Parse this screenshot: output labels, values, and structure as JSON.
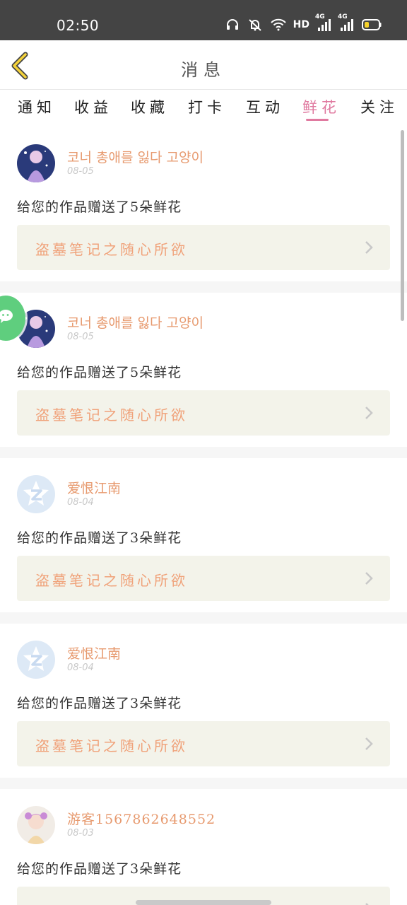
{
  "status_bar": {
    "time": "02:50",
    "network_label": "HD",
    "signal1_label": "4G",
    "signal2_label": "4G",
    "icons": [
      "headset-icon",
      "bell-muted-icon",
      "wifi-icon",
      "signal-icon",
      "signal-icon",
      "battery-icon"
    ],
    "battery_level": 0.25
  },
  "header": {
    "title": "消息",
    "back_icon": "chevron-left-icon"
  },
  "tabs": [
    {
      "label": "通知",
      "active": false
    },
    {
      "label": "收益",
      "active": false
    },
    {
      "label": "收藏",
      "active": false
    },
    {
      "label": "打卡",
      "active": false
    },
    {
      "label": "互动",
      "active": false
    },
    {
      "label": "鲜花",
      "active": true
    },
    {
      "label": "关注",
      "active": false
    }
  ],
  "messages": [
    {
      "sender": "코너 총애를 잃다 고양이",
      "date": "08-05",
      "text": "给您的作品赠送了5朵鲜花",
      "work_title": "盗墓笔记之随心所欲",
      "avatar": "anime-girl-avatar"
    },
    {
      "sender": "코너 총애를 잃다 고양이",
      "date": "08-05",
      "text": "给您的作品赠送了5朵鲜花",
      "work_title": "盗墓笔记之随心所欲",
      "avatar": "anime-girl-avatar"
    },
    {
      "sender": "爱恨江南",
      "date": "08-04",
      "text": "给您的作品赠送了3朵鲜花",
      "work_title": "盗墓笔记之随心所欲",
      "avatar": "default-z-avatar"
    },
    {
      "sender": "爱恨江南",
      "date": "08-04",
      "text": "给您的作品赠送了3朵鲜花",
      "work_title": "盗墓笔记之随心所欲",
      "avatar": "default-z-avatar"
    },
    {
      "sender": "游客1567862648552",
      "date": "08-03",
      "text": "给您的作品赠送了3朵鲜花",
      "work_title": "",
      "avatar": "anime-girl-avatar-pink"
    }
  ],
  "floating_button": {
    "icon": "wechat-icon"
  },
  "colors": {
    "accent_pink": "#e07aa0",
    "sender_orange": "#e79a6f",
    "work_title_orange": "#f0a27a",
    "link_bg": "#f3f3ea",
    "wechat_green": "#5fce7e"
  }
}
